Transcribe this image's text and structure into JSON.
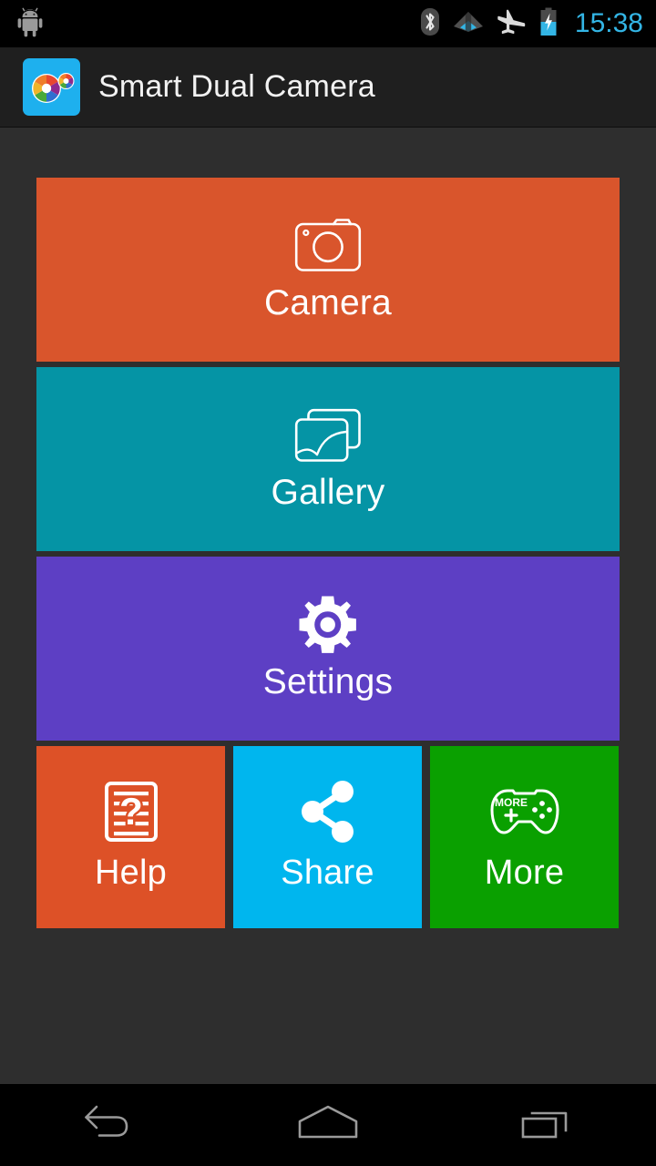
{
  "status_bar": {
    "notification_icon": "android-robot-icon",
    "icons": [
      {
        "name": "bluetooth-icon",
        "label": "Bluetooth"
      },
      {
        "name": "wifi-icon",
        "label": "Wi-Fi"
      },
      {
        "name": "airplane-mode-icon",
        "label": "Airplane mode"
      },
      {
        "name": "battery-charging-icon",
        "label": "Battery charging"
      }
    ],
    "clock": "15:38",
    "clock_color": "#33b5e5",
    "background": "#000000"
  },
  "action_bar": {
    "title": "Smart Dual Camera",
    "icon": "smart-dual-camera-app-icon",
    "background": "#1f1f1f",
    "icon_background": "#1eb0ee"
  },
  "content": {
    "background": "#2e2e2e",
    "tiles": [
      {
        "id": "camera",
        "label": "Camera",
        "icon": "camera-icon",
        "color": "#d9552c",
        "size": "wide"
      },
      {
        "id": "gallery",
        "label": "Gallery",
        "icon": "photos-stack-icon",
        "color": "#0594a5",
        "size": "wide"
      },
      {
        "id": "settings",
        "label": "Settings",
        "icon": "gear-icon",
        "color": "#5d3fc4",
        "size": "wide"
      },
      {
        "id": "help",
        "label": "Help",
        "icon": "faq-document-icon",
        "color": "#dd5127",
        "size": "small"
      },
      {
        "id": "share",
        "label": "Share",
        "icon": "share-nodes-icon",
        "color": "#00b6ee",
        "size": "small"
      },
      {
        "id": "more",
        "label": "More",
        "icon": "gamepad-more-icon",
        "icon_text": "MORE",
        "color": "#0aa000",
        "size": "small"
      }
    ]
  },
  "nav_bar": {
    "background": "#000000",
    "buttons": [
      {
        "name": "back-button",
        "icon": "back-arrow-icon",
        "label": "Back"
      },
      {
        "name": "home-button",
        "icon": "home-icon",
        "label": "Home"
      },
      {
        "name": "recents-button",
        "icon": "recents-icon",
        "label": "Recent apps"
      }
    ]
  }
}
